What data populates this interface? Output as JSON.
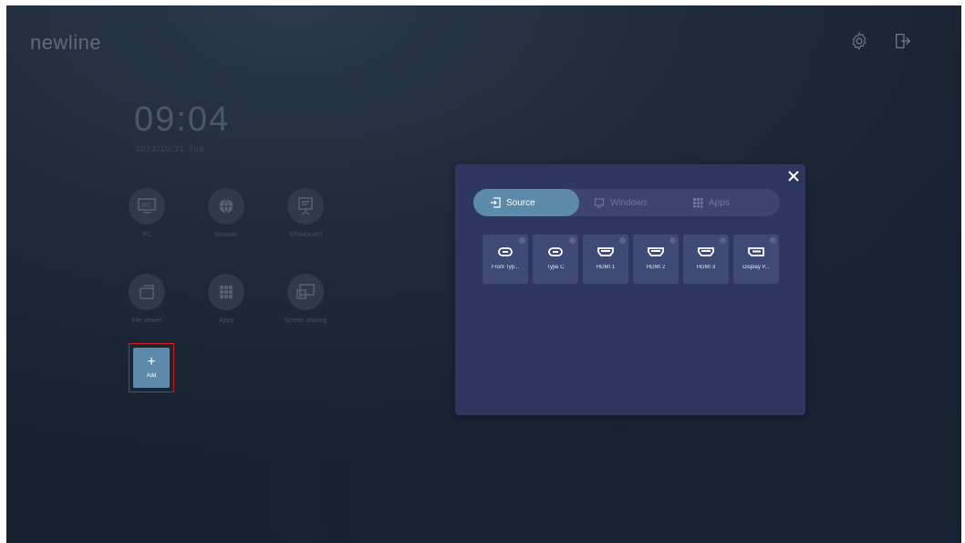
{
  "brand": {
    "logo_text": "newline"
  },
  "header": {
    "icons": [
      "settings-icon",
      "sign-out-icon"
    ]
  },
  "clock": {
    "time": "09:04",
    "date": "2023/10/31 Tue"
  },
  "apps": [
    {
      "label": "PC",
      "icon": "pc-icon"
    },
    {
      "label": "Browser",
      "icon": "globe-icon"
    },
    {
      "label": "Whiteboard",
      "icon": "whiteboard-icon"
    },
    {
      "label": "File viewer",
      "icon": "folder-icon"
    },
    {
      "label": "Apps",
      "icon": "grid-icon"
    },
    {
      "label": "Screen sharing",
      "icon": "screen-share-icon"
    }
  ],
  "add": {
    "label": "Add",
    "symbol": "+"
  },
  "panel": {
    "tabs": [
      {
        "label": "Source",
        "icon": "source-input-icon",
        "active": true
      },
      {
        "label": "Windows",
        "icon": "monitor-icon",
        "active": false
      },
      {
        "label": "Apps",
        "icon": "grid-icon",
        "active": false
      }
    ],
    "sources": [
      {
        "label": "Front Typ...",
        "icon": "usb-c-icon"
      },
      {
        "label": "Type C",
        "icon": "usb-c-icon"
      },
      {
        "label": "HDMI 1",
        "icon": "hdmi-icon"
      },
      {
        "label": "HDMI 2",
        "icon": "hdmi-icon"
      },
      {
        "label": "HDMI 3",
        "icon": "hdmi-icon"
      },
      {
        "label": "Display P...",
        "icon": "displayport-icon"
      }
    ]
  },
  "colors": {
    "accent": "#5d8aa8",
    "panel_bg": "#2e3760",
    "highlight_border": "#d21f1f"
  }
}
